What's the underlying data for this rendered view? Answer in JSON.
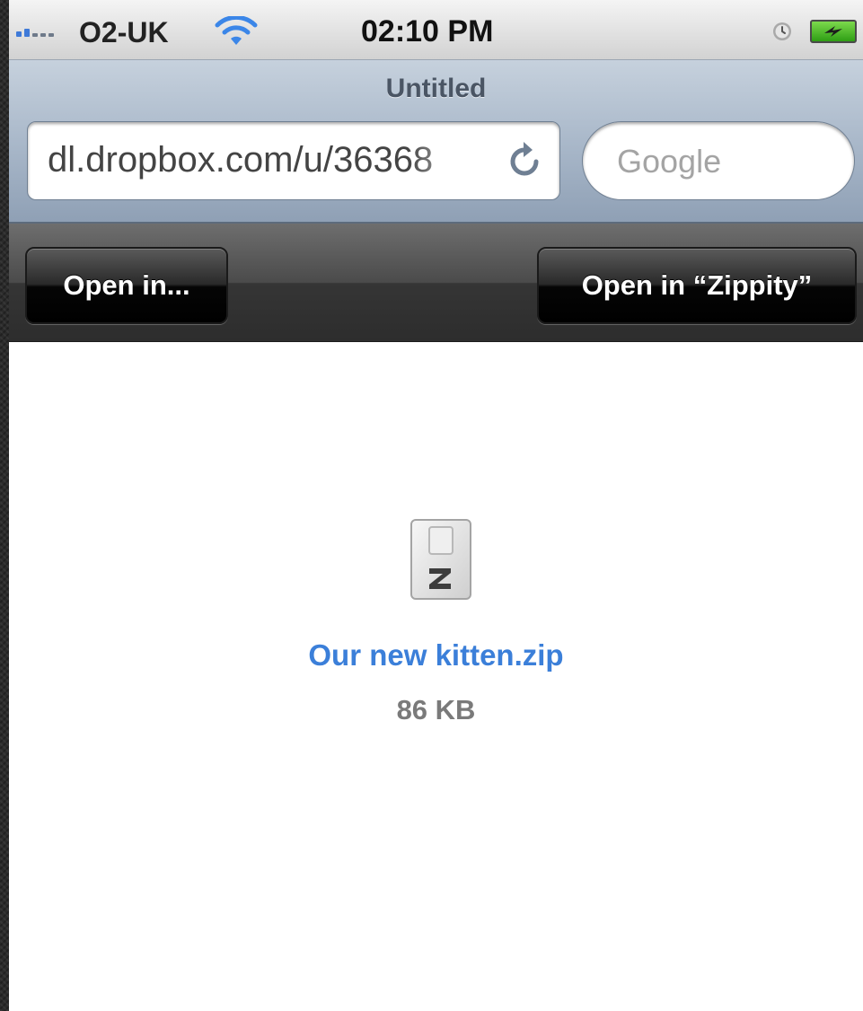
{
  "status_bar": {
    "carrier": "O2-UK",
    "time": "02:10 PM",
    "signal_bars_active": 2,
    "signal_bars_total": 5,
    "icons": [
      "signal-icon",
      "wifi-icon",
      "alarm-icon",
      "battery-charging-icon"
    ]
  },
  "browser": {
    "page_title": "Untitled",
    "url": "dl.dropbox.com/u/36368",
    "search_placeholder": "Google",
    "icons": [
      "reload-icon"
    ]
  },
  "toolbar": {
    "open_in_label": "Open in...",
    "open_in_app_label": "Open in “Zippity”"
  },
  "file": {
    "name": "Our new kitten.zip",
    "size": "86 KB",
    "icon": "zip-file-icon"
  },
  "colors": {
    "link": "#3b7fd9",
    "signal_active": "#3f7ad8",
    "wifi": "#3b86e8",
    "battery": "#4cc22a"
  }
}
